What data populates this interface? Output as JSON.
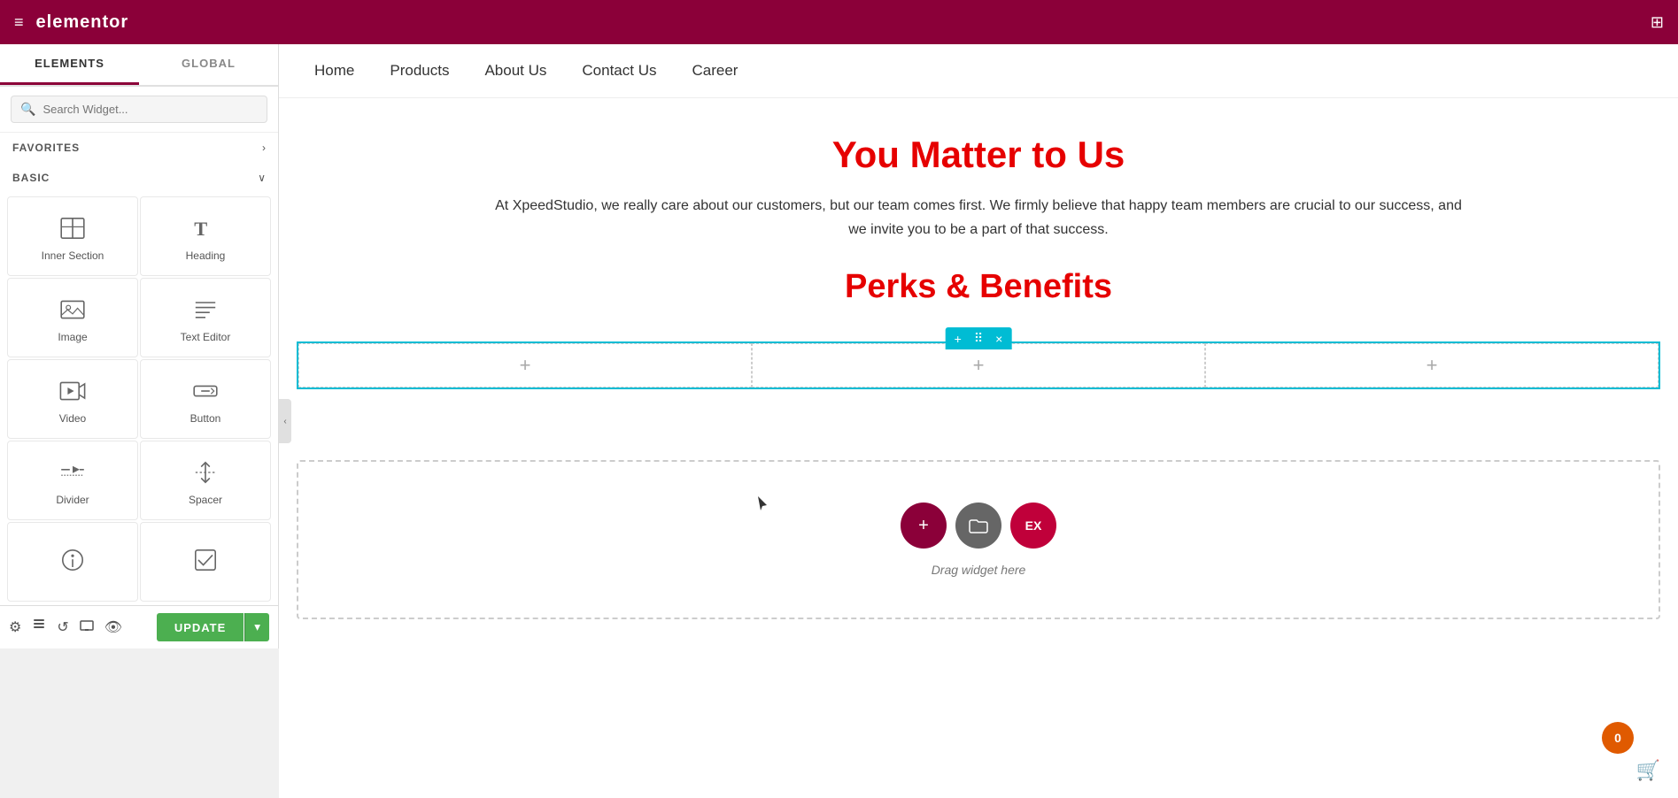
{
  "topbar": {
    "logo": "elementor",
    "hamburger_label": "≡",
    "grid_label": "⊞"
  },
  "panel": {
    "tabs": [
      {
        "label": "ELEMENTS",
        "active": true
      },
      {
        "label": "GLOBAL",
        "active": false
      }
    ],
    "search_placeholder": "Search Widget...",
    "sections": [
      {
        "id": "favorites",
        "label": "FAVORITES",
        "expanded": false,
        "arrow": "›"
      },
      {
        "id": "basic",
        "label": "BASIC",
        "expanded": true,
        "arrow": "∨"
      }
    ],
    "widgets": [
      {
        "id": "inner-section",
        "label": "Inner Section",
        "icon": "inner-section"
      },
      {
        "id": "heading",
        "label": "Heading",
        "icon": "heading"
      },
      {
        "id": "image",
        "label": "Image",
        "icon": "image"
      },
      {
        "id": "text-editor",
        "label": "Text Editor",
        "icon": "text-editor"
      },
      {
        "id": "video",
        "label": "Video",
        "icon": "video"
      },
      {
        "id": "button",
        "label": "Button",
        "icon": "button"
      },
      {
        "id": "divider",
        "label": "Divider",
        "icon": "divider"
      },
      {
        "id": "spacer",
        "label": "Spacer",
        "icon": "spacer"
      },
      {
        "id": "widget8",
        "label": "",
        "icon": "w8"
      },
      {
        "id": "widget9",
        "label": "",
        "icon": "w9"
      }
    ],
    "bottom_icons": [
      "settings",
      "layers",
      "history",
      "responsive",
      "hide"
    ],
    "update_btn": "UPDATE"
  },
  "canvas": {
    "nav_items": [
      "Home",
      "Products",
      "About Us",
      "Contact Us",
      "Career"
    ],
    "hero_title": "You Matter to Us",
    "hero_description": "At XpeedStudio, we really care about our customers, but our team comes first. We firmly believe that happy team members are crucial to our success, and we invite you to be a part of that success.",
    "perks_title": "Perks & Benefits",
    "row_controls": [
      "+",
      "⠿",
      "×"
    ],
    "col_add_label": "+",
    "drop_zone_label": "Drag widget here",
    "badge_count": "0"
  },
  "colors": {
    "brand": "#8b0039",
    "selected_border": "#00bcd4",
    "red_text": "#e60000",
    "green_btn": "#4caf50"
  }
}
